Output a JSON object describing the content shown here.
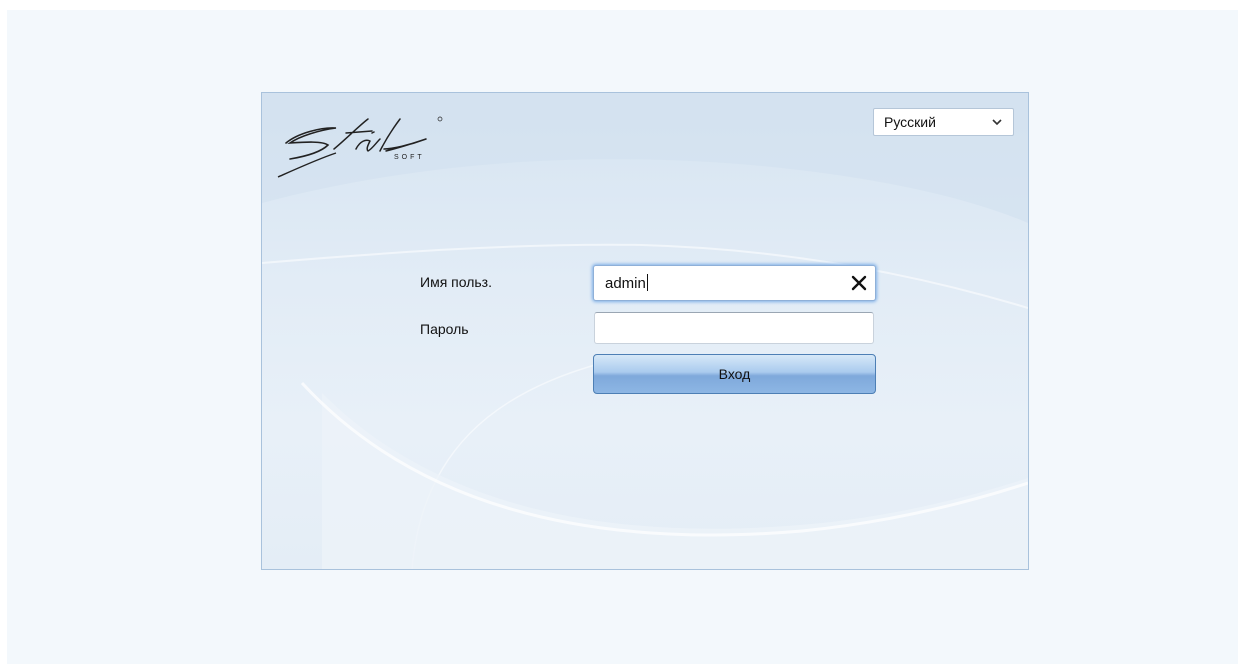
{
  "brand": {
    "logo_name": "Stil soft"
  },
  "language_select": {
    "value": "Русский",
    "icon": "chevron-down-icon"
  },
  "login_form": {
    "username_label": "Имя польз.",
    "username_value": "admin",
    "password_label": "Пароль",
    "password_value": "",
    "clear_icon": "close-icon",
    "submit_label": "Вход"
  },
  "colors": {
    "page_background": "#f3f8fc",
    "panel_background": "#dfe9f4",
    "panel_border": "#a9c2dc",
    "button_gradient_top": "#d6e8f8",
    "button_gradient_bottom": "#7fa9db",
    "focus_glow": "#7fb0e8"
  }
}
